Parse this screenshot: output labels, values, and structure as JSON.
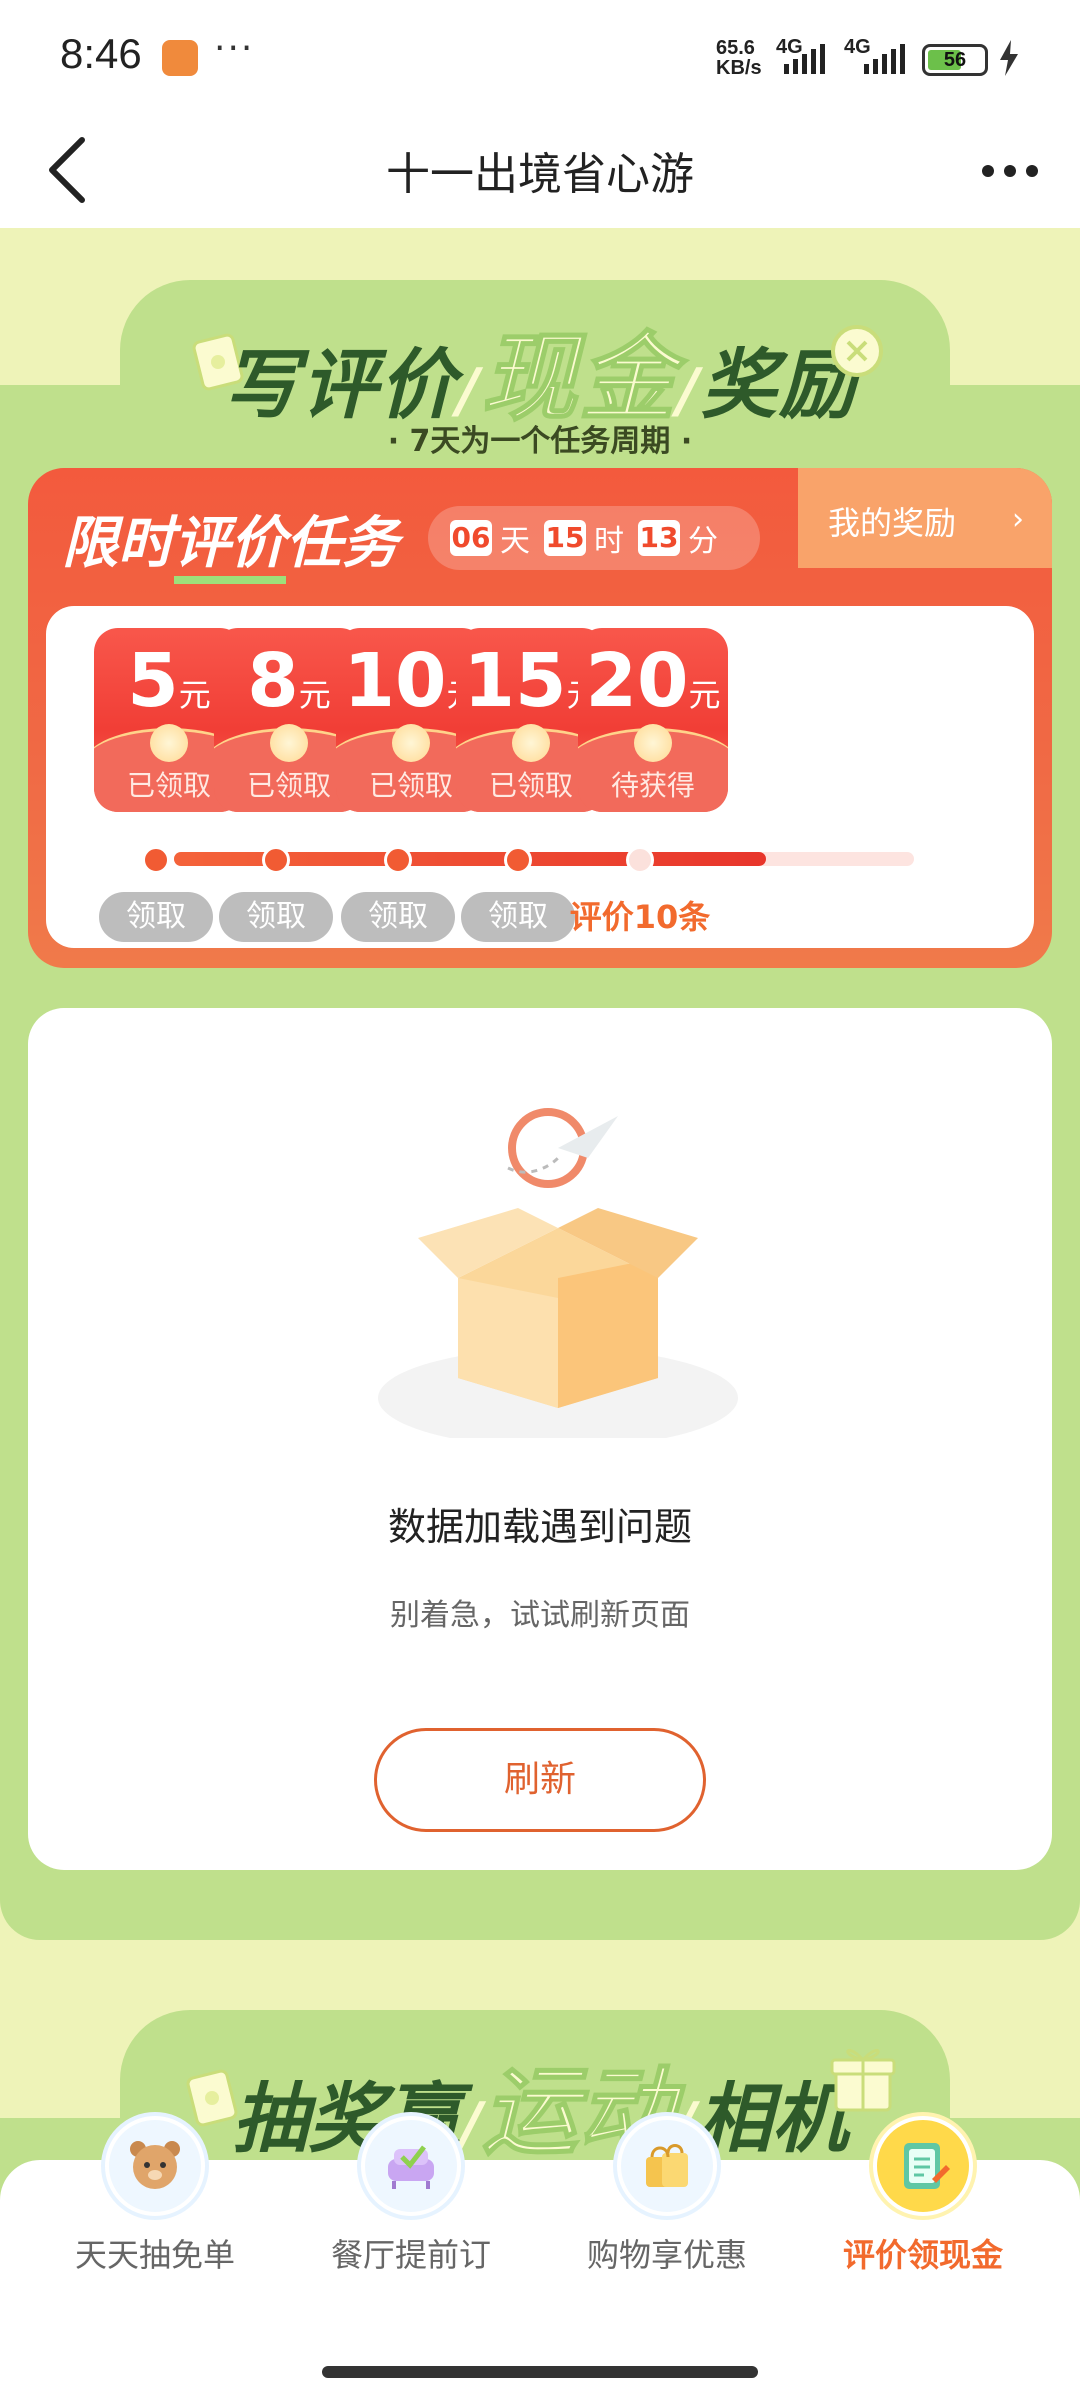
{
  "status_bar": {
    "time": "8:46",
    "more": "···",
    "speed_value": "65.6",
    "speed_unit": "KB/s",
    "net1": "4G",
    "net2": "4G",
    "battery": "56"
  },
  "nav": {
    "title": "十一出境省心游"
  },
  "banner": {
    "part1": "写评价",
    "highlight": "现金",
    "part2": "奖励",
    "separator": "/",
    "subtitle": "· 7天为一个任务周期 ·"
  },
  "task": {
    "title_prefix": "限时",
    "title_highlight": "评价",
    "title_suffix": "任务",
    "countdown": {
      "days": "06",
      "days_unit": "天",
      "hours": "15",
      "hours_unit": "时",
      "minutes": "13",
      "minutes_unit": "分"
    },
    "my_reward": "我的奖励",
    "my_reward_arrow": "›",
    "currency": "元",
    "rewards": [
      {
        "amount": "5",
        "status": "已领取",
        "action": "领取"
      },
      {
        "amount": "8",
        "status": "已领取",
        "action": "领取"
      },
      {
        "amount": "10",
        "status": "已领取",
        "action": "领取"
      },
      {
        "amount": "15",
        "status": "已领取",
        "action": "领取"
      },
      {
        "amount": "20",
        "status": "待获得",
        "action": "评价10条"
      }
    ],
    "progress_percent": 80
  },
  "error": {
    "title": "数据加载遇到问题",
    "subtitle": "别着急，试试刷新页面",
    "refresh": "刷新"
  },
  "second_banner": {
    "part1": "抽奖赢",
    "highlight": "运动",
    "part2": "相机",
    "separator": "/"
  },
  "tabs": [
    {
      "label": "天天抽免单",
      "icon": "bear-icon",
      "active": false
    },
    {
      "label": "餐厅提前订",
      "icon": "sofa-icon",
      "active": false
    },
    {
      "label": "购物享优惠",
      "icon": "shopping-bag-icon",
      "active": false
    },
    {
      "label": "评价领现金",
      "icon": "review-notepad-icon",
      "active": true
    }
  ],
  "colors": {
    "accent": "#f26a2d",
    "task_red": "#f35a3d",
    "green_bg": "#bfe08c",
    "page_bg": "#eef3b8"
  }
}
